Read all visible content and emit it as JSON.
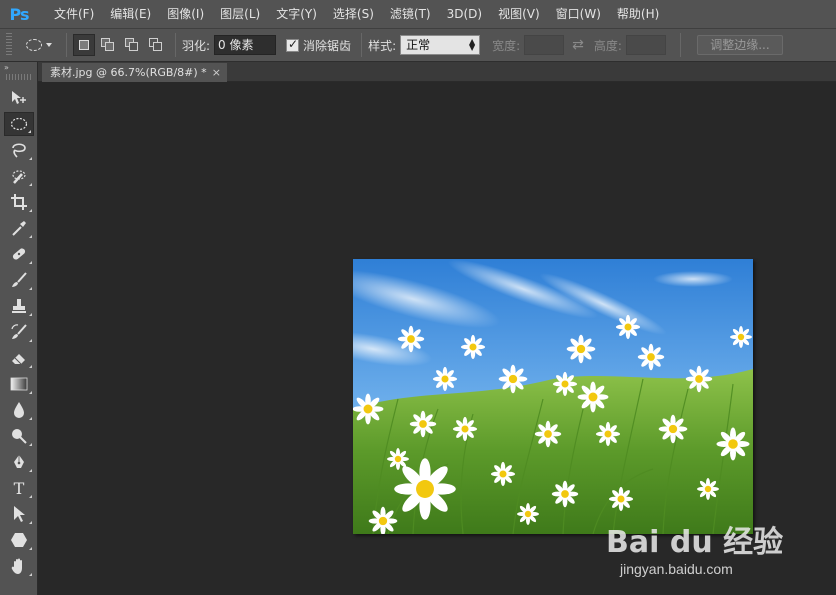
{
  "app": {
    "logo": "Ps"
  },
  "menu": [
    {
      "label": "文件(F)"
    },
    {
      "label": "编辑(E)"
    },
    {
      "label": "图像(I)"
    },
    {
      "label": "图层(L)"
    },
    {
      "label": "文字(Y)"
    },
    {
      "label": "选择(S)"
    },
    {
      "label": "滤镜(T)"
    },
    {
      "label": "3D(D)"
    },
    {
      "label": "视图(V)"
    },
    {
      "label": "窗口(W)"
    },
    {
      "label": "帮助(H)"
    }
  ],
  "options": {
    "feather_label": "羽化:",
    "feather_value": "0 像素",
    "antialias_label": "消除锯齿",
    "antialias_checked": true,
    "style_label": "样式:",
    "style_value": "正常",
    "width_label": "宽度:",
    "height_label": "高度:",
    "refine_edge_label": "调整边缘..."
  },
  "document": {
    "tab_title": "素材.jpg @ 66.7%(RGB/8#) *",
    "close_symbol": "×"
  },
  "toolbar": {
    "collapse_symbol": "»",
    "tools": [
      {
        "name": "move-tool",
        "icon": "move-icon",
        "active": false
      },
      {
        "name": "elliptical-marquee-tool",
        "icon": "ellipse-marquee-icon",
        "active": true
      },
      {
        "name": "lasso-tool",
        "icon": "lasso-icon",
        "active": false
      },
      {
        "name": "quick-selection-tool",
        "icon": "quick-selection-icon",
        "active": false
      },
      {
        "name": "crop-tool",
        "icon": "crop-icon",
        "active": false
      },
      {
        "name": "eyedropper-tool",
        "icon": "eyedropper-icon",
        "active": false
      },
      {
        "name": "healing-brush-tool",
        "icon": "bandage-icon",
        "active": false
      },
      {
        "name": "brush-tool",
        "icon": "brush-icon",
        "active": false
      },
      {
        "name": "clone-stamp-tool",
        "icon": "stamp-icon",
        "active": false
      },
      {
        "name": "history-brush-tool",
        "icon": "history-brush-icon",
        "active": false
      },
      {
        "name": "eraser-tool",
        "icon": "eraser-icon",
        "active": false
      },
      {
        "name": "gradient-tool",
        "icon": "gradient-icon",
        "active": false
      },
      {
        "name": "blur-tool",
        "icon": "droplet-icon",
        "active": false
      },
      {
        "name": "dodge-tool",
        "icon": "dodge-icon",
        "active": false
      },
      {
        "name": "pen-tool",
        "icon": "pen-icon",
        "active": false
      },
      {
        "name": "type-tool",
        "icon": "type-icon",
        "active": false,
        "glyph": "T"
      },
      {
        "name": "path-selection-tool",
        "icon": "arrow-icon",
        "active": false
      },
      {
        "name": "shape-tool",
        "icon": "hexagon-icon",
        "active": false
      },
      {
        "name": "hand-tool",
        "icon": "hand-icon",
        "active": false
      }
    ]
  },
  "watermark": {
    "title": "Bai du 经验",
    "subtitle": "jingyan.baidu.com"
  },
  "colors": {
    "chrome": "#535353",
    "canvas": "#282828",
    "sky_top": "#2f7fd6",
    "sky_bottom": "#9cc8ee",
    "grass": "#5c9a2a",
    "ps_blue": "#31a8ff"
  }
}
